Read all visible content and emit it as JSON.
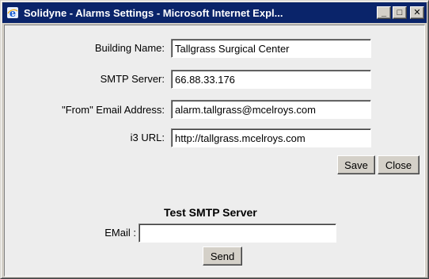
{
  "window": {
    "title": "Solidyne - Alarms Settings - Microsoft Internet Expl...",
    "minimize_glyph": "_",
    "maximize_glyph": "□",
    "close_glyph": "✕"
  },
  "form": {
    "building_name_label": "Building Name:",
    "building_name_value": "Tallgrass Surgical Center",
    "smtp_server_label": "SMTP Server:",
    "smtp_server_value": "66.88.33.176",
    "from_email_label": "\"From\" Email Address:",
    "from_email_value": "alarm.tallgrass@mcelroys.com",
    "i3_url_label": "i3 URL:",
    "i3_url_value": "http://tallgrass.mcelroys.com",
    "save_label": "Save",
    "close_label": "Close"
  },
  "test_smtp": {
    "heading": "Test SMTP Server",
    "email_label": "EMail :",
    "email_value": "",
    "send_label": "Send"
  },
  "colors": {
    "titlebar": "#0a246a",
    "window_face": "#d4d0c8",
    "content_bg": "#ededed"
  },
  "icons": {
    "title_icon": "internet-explorer-icon"
  }
}
